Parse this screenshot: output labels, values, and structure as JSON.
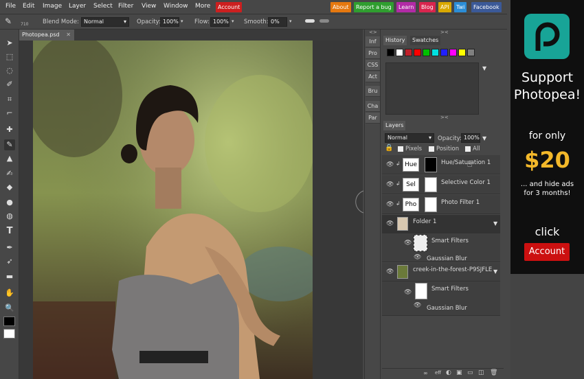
{
  "menu": {
    "items": [
      "File",
      "Edit",
      "Image",
      "Layer",
      "Select",
      "Filter",
      "View",
      "Window",
      "More"
    ],
    "account": "Account",
    "links": [
      {
        "label": "About",
        "color": "#e5780f"
      },
      {
        "label": "Report a bug",
        "color": "#2f9e2f"
      },
      {
        "label": "Learn",
        "color": "#b22aa6"
      },
      {
        "label": "Blog",
        "color": "#d9254e"
      },
      {
        "label": "API",
        "color": "#d9a800"
      },
      {
        "label": "Twi",
        "color": "#2b8dd6"
      },
      {
        "label": "Facebook",
        "color": "#3b5998"
      }
    ]
  },
  "options": {
    "brush_size": "710",
    "blend_label": "Blend Mode:",
    "blend_value": "Normal",
    "opacity_label": "Opacity:",
    "opacity_value": "100%",
    "flow_label": "Flow:",
    "flow_value": "100%",
    "smooth_label": "Smooth:",
    "smooth_value": "0%"
  },
  "document": {
    "tab_title": "Photopea.psd",
    "close": "✕"
  },
  "side_strip": [
    "Inf",
    "Pro",
    "CSS",
    "Act",
    "Bru",
    "Cha",
    "Par"
  ],
  "panels": {
    "history_tab": "History",
    "swatches_tab": "Swatches",
    "swatch_colors": [
      "#000000",
      "#ffffff",
      "#c0202a",
      "#ff0000",
      "#00c000",
      "#00e0e0",
      "#2020ff",
      "#ff00ff",
      "#ffff00",
      "#808080"
    ],
    "layers_tab": "Layers",
    "layer_blend": "Normal",
    "opacity_label": "Opacity:",
    "opacity_value": "100%",
    "lock_pixels": "Pixels",
    "lock_position": "Position",
    "lock_all": "All"
  },
  "layers": [
    {
      "thumb": "Hue",
      "name": "Hue/Saturation 1"
    },
    {
      "thumb": "Sel",
      "name": "Selective Color 1"
    },
    {
      "thumb": "Pho",
      "name": "Photo Filter 1"
    },
    {
      "name": "Folder 1"
    },
    {
      "name": "Smart Filters"
    },
    {
      "name": "Gaussian Blur"
    },
    {
      "name": "creek-in-the-forest-P9SJFLE"
    },
    {
      "name": "Smart Filters"
    },
    {
      "name": "Gaussian Blur"
    }
  ],
  "bottom_icons": [
    "link-icon",
    "fx-icon",
    "adjust-icon",
    "mask-icon",
    "folder-icon",
    "new-layer-icon",
    "trash-icon"
  ],
  "ad": {
    "support": "Support",
    "brand": "Photopea!",
    "for_only": "for only",
    "price": "$20",
    "hide_ads": "... and hide ads",
    "months": "for 3 months!",
    "click": "click",
    "account": "Account"
  }
}
